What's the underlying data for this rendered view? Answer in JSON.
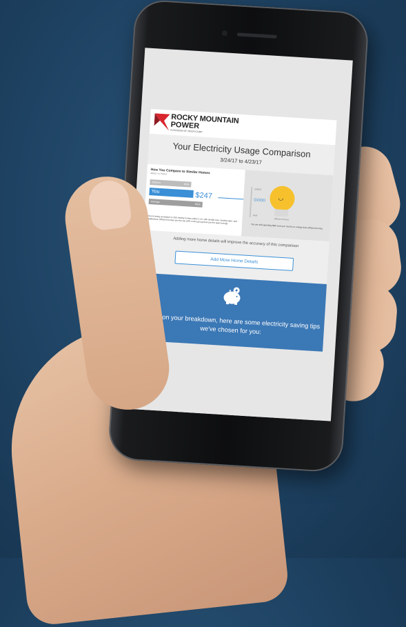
{
  "colors": {
    "background": "#1e4262",
    "brand_red": "#d8262f",
    "accent_blue": "#3a8fd6",
    "tips_panel": "#3b78b6",
    "bulb_yellow": "#f6c12d"
  },
  "brand": {
    "name_line1": "ROCKY MOUNTAIN",
    "name_line2": "POWER",
    "tagline": "A DIVISION OF PACIFICORP",
    "logo_icon": "rocky-mountain-power-logo"
  },
  "report": {
    "title": "Your Electricity Usage Comparison",
    "date_range": "3/24/17 to 4/23/17"
  },
  "comparison": {
    "heading": "How You Compare to Similar Homes",
    "subheading": "4/16/17 to 7/16/17",
    "bars": [
      {
        "label": "Efficient",
        "value": "$165",
        "color": "#bcbcbc"
      },
      {
        "label": "You",
        "value": "$247",
        "color": "#3a8fd6"
      },
      {
        "label": "Average",
        "value": "$324",
        "color": "#9e9e9e"
      }
    ],
    "you_amount": "$247",
    "scale_top": "GREAT",
    "scale_mid": "GOOD",
    "scale_bottom": "FAIR",
    "bulb_icon": "smiling-lightbulb-icon",
    "bulb_caption": "Efficient Homes",
    "description": "You're being compared to 100 nearby homes within 1 mi. with similar size, heating type, and appliances. Efficient homes are the top 20% in this group that use the least energy.",
    "right_text": "You are still spending $84 more per month on energy than efficient homes."
  },
  "details": {
    "note": "Adding more home details will improve the accuracy of this comparison",
    "button_label": "Add More Home Details"
  },
  "tips": {
    "icon": "piggy-bank-icon",
    "text": "Based on your breakdown, here are some electricity saving tips we've chosen for you:"
  }
}
